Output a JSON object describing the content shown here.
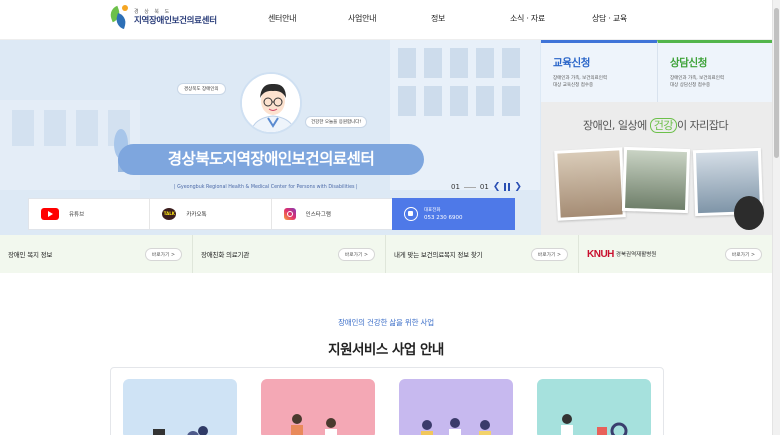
{
  "header": {
    "logo_sub": "경 상 북 도",
    "logo_title": "지역장애인보건의료센터",
    "nav": [
      "센터안내",
      "사업안내",
      "정보",
      "소식 · 자료",
      "상담 · 교육"
    ]
  },
  "hero": {
    "badge": "경상북도 장애인의",
    "cheer": "건강한 오늘을 응원합니다!",
    "title": "경상북도지역장애인보건의료센터",
    "subtitle_en": "| Gyeongbuk Regional Health & Medical Center for Persons with Disabilities |",
    "slide_current": "01",
    "slide_total": "01"
  },
  "sns": [
    {
      "label": "유튜브",
      "icon": "youtube-icon"
    },
    {
      "label": "카카오톡",
      "icon": "kakaotalk-icon"
    },
    {
      "label": "인스타그램",
      "icon": "instagram-icon"
    }
  ],
  "phone": {
    "label": "대표전화",
    "number": "053 230 6900"
  },
  "apply": {
    "edu": {
      "title": "교육신청",
      "desc": "장애인과 가족, 보건의료인력\n대상 교육신청 접수중"
    },
    "consult": {
      "title": "상담신청",
      "desc": "장애인과 가족, 보건의료인력\n대상 상담신청 접수중"
    }
  },
  "promo": {
    "text_before": "장애인, 일상에",
    "highlight": "건강",
    "text_after": "이 자리잡다"
  },
  "quick_links": [
    {
      "label": "장애인 복지 정보",
      "go": "바로가기 >"
    },
    {
      "label": "장애친화 의료기관",
      "go": "바로가기 >"
    },
    {
      "label": "내게 맞는 보건의료복지 정보 찾기",
      "go": "바로가기 >"
    },
    {
      "label": "경북권역재활병원",
      "brand": "KNUH",
      "go": "바로가기 >"
    }
  ],
  "section": {
    "subtitle": "장애인의 건강한 삶을 위한 사업",
    "title": "지원서비스 사업 안내"
  },
  "colors": {
    "primary_blue": "#4e79e8",
    "hero_bg": "#dde9f5",
    "accent_green": "#52b54b",
    "links_bg": "#f2f8ee",
    "knuh_red": "#c8102e"
  }
}
